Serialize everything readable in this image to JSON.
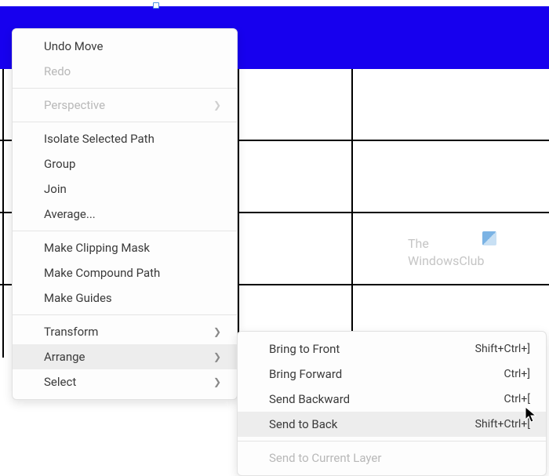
{
  "watermark": {
    "line1": "The",
    "line2": "WindowsClub"
  },
  "main_menu": {
    "items": [
      {
        "label": "Undo Move",
        "disabled": false,
        "submenu": false
      },
      {
        "label": "Redo",
        "disabled": true,
        "submenu": false
      },
      {
        "separator": true
      },
      {
        "label": "Perspective",
        "disabled": true,
        "submenu": true
      },
      {
        "separator": true
      },
      {
        "label": "Isolate Selected Path",
        "disabled": false,
        "submenu": false
      },
      {
        "label": "Group",
        "disabled": false,
        "submenu": false
      },
      {
        "label": "Join",
        "disabled": false,
        "submenu": false
      },
      {
        "label": "Average...",
        "disabled": false,
        "submenu": false
      },
      {
        "separator": true
      },
      {
        "label": "Make Clipping Mask",
        "disabled": false,
        "submenu": false
      },
      {
        "label": "Make Compound Path",
        "disabled": false,
        "submenu": false
      },
      {
        "label": "Make Guides",
        "disabled": false,
        "submenu": false
      },
      {
        "separator": true
      },
      {
        "label": "Transform",
        "disabled": false,
        "submenu": true
      },
      {
        "label": "Arrange",
        "disabled": false,
        "submenu": true,
        "hovered": true
      },
      {
        "label": "Select",
        "disabled": false,
        "submenu": true
      }
    ]
  },
  "sub_menu": {
    "items": [
      {
        "label": "Bring to Front",
        "shortcut": "Shift+Ctrl+]"
      },
      {
        "label": "Bring Forward",
        "shortcut": "Ctrl+]"
      },
      {
        "label": "Send Backward",
        "shortcut": "Ctrl+["
      },
      {
        "label": "Send to Back",
        "shortcut": "Shift+Ctrl+[",
        "hovered": true
      },
      {
        "separator": true
      },
      {
        "label": "Send to Current Layer",
        "disabled": true
      }
    ]
  },
  "chevron": "❯"
}
